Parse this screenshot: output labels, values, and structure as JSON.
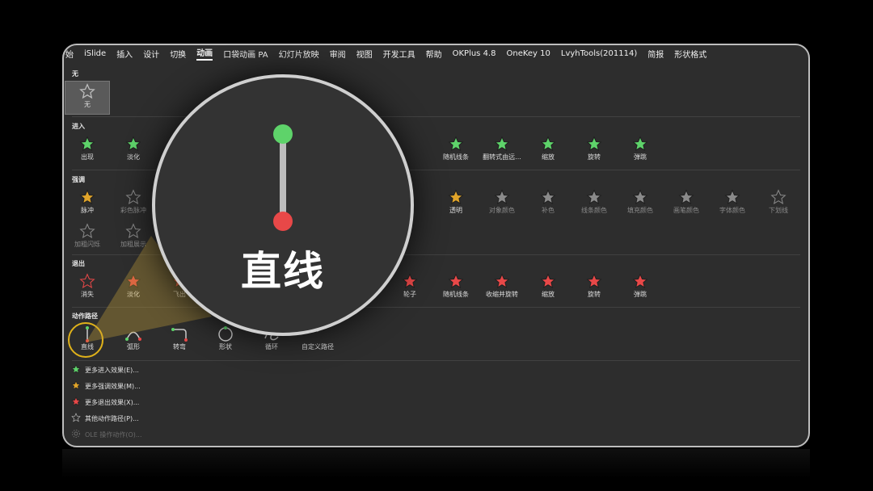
{
  "ribbon": {
    "tabs": [
      "开始",
      "iSlide",
      "插入",
      "设计",
      "切换",
      "动画",
      "口袋动画 PA",
      "幻灯片放映",
      "审阅",
      "视图",
      "开发工具",
      "帮助",
      "OKPlus 4.8",
      "OneKey 10",
      "LvyhTools(201114)",
      "简报",
      "形状格式"
    ],
    "active_tab": "动画"
  },
  "sections": {
    "none": {
      "title": "无",
      "items": [
        "无"
      ]
    },
    "entrance": {
      "title": "进入",
      "items": [
        "出现",
        "淡化",
        "随机线条",
        "翻转式由远...",
        "缩放",
        "旋转",
        "弹跳"
      ]
    },
    "emphasis": {
      "title": "强调",
      "items": [
        "脉冲",
        "彩色脉冲",
        "透明",
        "对象颜色",
        "补色",
        "线条颜色",
        "填充颜色",
        "画笔颜色",
        "字体颜色",
        "下划线",
        "加粗闪烁",
        "加粗展示"
      ]
    },
    "exit": {
      "title": "退出",
      "items": [
        "消失",
        "淡化",
        "飞出",
        "轮子",
        "随机线条",
        "收缩并旋转",
        "缩放",
        "旋转",
        "弹跳"
      ]
    },
    "motion": {
      "title": "动作路径",
      "items": [
        "直线",
        "弧形",
        "转弯",
        "形状",
        "循环",
        "自定义路径"
      ]
    }
  },
  "menu": [
    {
      "label": "更多进入效果(E)...",
      "icon": "star-green-icon"
    },
    {
      "label": "更多强调效果(M)...",
      "icon": "star-gold-icon"
    },
    {
      "label": "更多退出效果(X)...",
      "icon": "star-red-icon"
    },
    {
      "label": "其他动作路径(P)...",
      "icon": "star-outline-icon"
    },
    {
      "label": "OLE 操作动作(O)...",
      "icon": "gear-icon"
    }
  ],
  "magnifier": {
    "label": "直线"
  },
  "colors": {
    "green": "#5ed36a",
    "red": "#e84848",
    "gold": "#e0a42a",
    "gray": "#8a8a8a",
    "highlight": "#e0b21a"
  }
}
